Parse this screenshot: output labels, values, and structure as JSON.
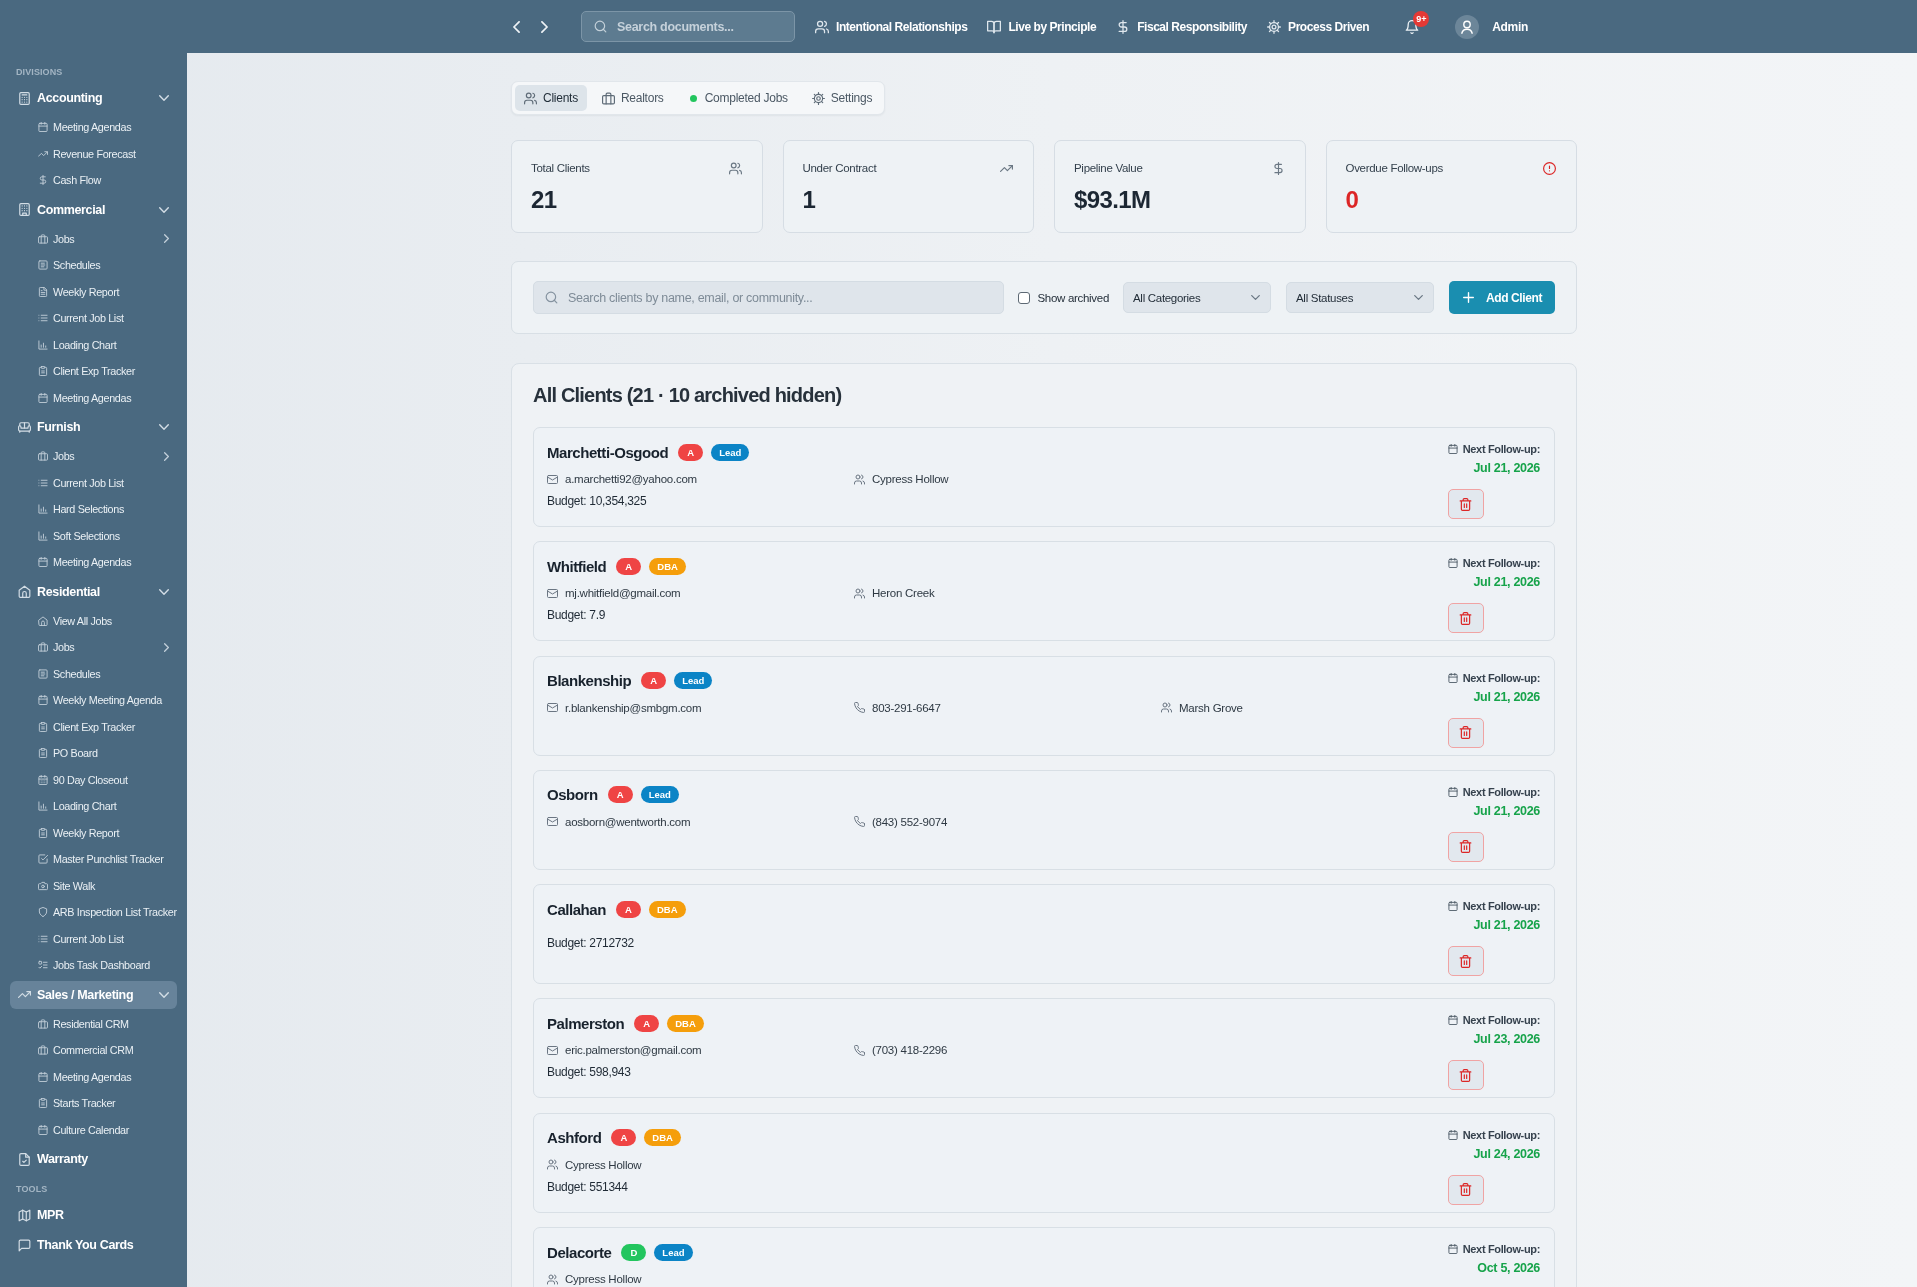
{
  "sidebar": {
    "sections": [
      {
        "label": "DIVISIONS",
        "items": [
          {
            "label": "Accounting",
            "kind": "group",
            "selected": false,
            "expanded": true,
            "children": [
              {
                "label": "Meeting Agendas",
                "kind": "link",
                "selected": false
              },
              {
                "label": "Revenue Forecast",
                "kind": "link",
                "selected": false
              },
              {
                "label": "Cash Flow",
                "kind": "link",
                "selected": false
              }
            ]
          },
          {
            "label": "Commercial",
            "kind": "group",
            "selected": false,
            "expanded": true,
            "children": [
              {
                "label": "Jobs",
                "kind": "submenu",
                "selected": false,
                "expanded": false
              },
              {
                "label": "Schedules",
                "kind": "link",
                "selected": false
              },
              {
                "label": "Weekly Report",
                "kind": "link",
                "selected": false
              },
              {
                "label": "Current Job List",
                "kind": "link",
                "selected": false
              },
              {
                "label": "Loading Chart",
                "kind": "link",
                "selected": false
              },
              {
                "label": "Client Exp Tracker",
                "kind": "link",
                "selected": false
              },
              {
                "label": "Meeting Agendas",
                "kind": "link",
                "selected": false
              }
            ]
          },
          {
            "label": "Furnish",
            "kind": "group",
            "selected": false,
            "expanded": true,
            "children": [
              {
                "label": "Jobs",
                "kind": "submenu",
                "selected": false,
                "expanded": false
              },
              {
                "label": "Current Job List",
                "kind": "link",
                "selected": false
              },
              {
                "label": "Hard Selections",
                "kind": "link",
                "selected": false
              },
              {
                "label": "Soft Selections",
                "kind": "link",
                "selected": false
              },
              {
                "label": "Meeting Agendas",
                "kind": "link",
                "selected": false
              }
            ]
          },
          {
            "label": "Residential",
            "kind": "group",
            "selected": false,
            "expanded": true,
            "children": [
              {
                "label": "View All Jobs",
                "kind": "link",
                "selected": false
              },
              {
                "label": "Jobs",
                "kind": "submenu",
                "selected": false,
                "expanded": false
              },
              {
                "label": "Schedules",
                "kind": "link",
                "selected": false
              },
              {
                "label": "Weekly Meeting Agenda",
                "kind": "link",
                "selected": false
              },
              {
                "label": "Client Exp Tracker",
                "kind": "link",
                "selected": false
              },
              {
                "label": "PO Board",
                "kind": "link",
                "selected": false
              },
              {
                "label": "90 Day Closeout",
                "kind": "link",
                "selected": false
              },
              {
                "label": "Loading Chart",
                "kind": "link",
                "selected": false
              },
              {
                "label": "Weekly Report",
                "kind": "link",
                "selected": false
              },
              {
                "label": "Master Punchlist Tracker",
                "kind": "link",
                "selected": false
              },
              {
                "label": "Site Walk",
                "kind": "link",
                "selected": false
              },
              {
                "label": "ARB Inspection List Tracker",
                "kind": "link",
                "selected": false
              },
              {
                "label": "Current Job List",
                "kind": "link",
                "selected": false
              },
              {
                "label": "Jobs Task Dashboard",
                "kind": "link",
                "selected": false
              }
            ]
          },
          {
            "label": "Sales / Marketing",
            "kind": "group",
            "selected": true,
            "expanded": true,
            "children": [
              {
                "label": "Residential CRM",
                "kind": "link",
                "selected": false
              },
              {
                "label": "Commercial CRM",
                "kind": "link",
                "selected": false
              },
              {
                "label": "Meeting Agendas",
                "kind": "link",
                "selected": false
              },
              {
                "label": "Starts Tracker",
                "kind": "link",
                "selected": false
              },
              {
                "label": "Culture Calendar",
                "kind": "link",
                "selected": false
              }
            ]
          },
          {
            "label": "Warranty",
            "kind": "link",
            "selected": false
          }
        ]
      },
      {
        "label": "TOOLS",
        "items": [
          {
            "label": "MPR",
            "kind": "link",
            "selected": false
          },
          {
            "label": "Thank You Cards",
            "kind": "link",
            "selected": false
          }
        ]
      }
    ]
  },
  "topbar": {
    "search": {
      "placeholder": "Search documents..."
    },
    "links": [
      {
        "label": "Intentional Relationships"
      },
      {
        "label": "Live by Principle"
      },
      {
        "label": "Fiscal Responsibility"
      },
      {
        "label": "Process Driven"
      }
    ],
    "notifications": {
      "badge": "9+"
    },
    "user": {
      "name": "Admin"
    }
  },
  "tabs": [
    {
      "label": "Clients",
      "selected": true
    },
    {
      "label": "Realtors",
      "selected": false
    },
    {
      "label": "Completed Jobs",
      "selected": false
    },
    {
      "label": "Settings",
      "selected": false
    }
  ],
  "stats": [
    {
      "label": "Total Clients",
      "value": "21",
      "alert": false
    },
    {
      "label": "Under Contract",
      "value": "1",
      "alert": false
    },
    {
      "label": "Pipeline Value",
      "value": "$93.1M",
      "alert": false
    },
    {
      "label": "Overdue Follow-ups",
      "value": "0",
      "alert": true
    }
  ],
  "filters": {
    "search": {
      "placeholder": "Search clients by name, email, or community..."
    },
    "show_archived": {
      "label": "Show archived",
      "checked": false
    },
    "category": {
      "value": "All Categories"
    },
    "status": {
      "value": "All Statuses"
    },
    "add_button": {
      "label": "Add Client"
    }
  },
  "client_list": {
    "title": "All Clients (21 · 10 archived hidden)",
    "clients": [
      {
        "name": "Marchetti-Osgood",
        "badges": [
          {
            "label": "A",
            "color": "#ef4444"
          },
          {
            "label": "Lead",
            "color": "#0b84c6"
          }
        ],
        "contacts": [
          {
            "kind": "email",
            "text": "a.marchetti92@yahoo.com"
          },
          {
            "kind": "community",
            "text": "Cypress Hollow"
          }
        ],
        "budget": "Budget: 10,354,325",
        "follow_up": {
          "label": "Next Follow-up:",
          "date": "Jul 21, 2026"
        }
      },
      {
        "name": "Whitfield",
        "badges": [
          {
            "label": "A",
            "color": "#ef4444"
          },
          {
            "label": "DBA",
            "color": "#f59e0b"
          }
        ],
        "contacts": [
          {
            "kind": "email",
            "text": "mj.whitfield@gmail.com"
          },
          {
            "kind": "community",
            "text": "Heron Creek"
          }
        ],
        "budget": "Budget: 7.9",
        "follow_up": {
          "label": "Next Follow-up:",
          "date": "Jul 21, 2026"
        }
      },
      {
        "name": "Blankenship",
        "badges": [
          {
            "label": "A",
            "color": "#ef4444"
          },
          {
            "label": "Lead",
            "color": "#0b84c6"
          }
        ],
        "contacts": [
          {
            "kind": "email",
            "text": "r.blankenship@smbgm.com"
          },
          {
            "kind": "phone",
            "text": "803-291-6647"
          },
          {
            "kind": "community",
            "text": "Marsh Grove"
          }
        ],
        "follow_up": {
          "label": "Next Follow-up:",
          "date": "Jul 21, 2026"
        }
      },
      {
        "name": "Osborn",
        "badges": [
          {
            "label": "A",
            "color": "#ef4444"
          },
          {
            "label": "Lead",
            "color": "#0b84c6"
          }
        ],
        "contacts": [
          {
            "kind": "email",
            "text": "aosborn@wentworth.com"
          },
          {
            "kind": "phone",
            "text": "(843) 552-9074"
          }
        ],
        "follow_up": {
          "label": "Next Follow-up:",
          "date": "Jul 21, 2026"
        }
      },
      {
        "name": "Callahan",
        "badges": [
          {
            "label": "A",
            "color": "#ef4444"
          },
          {
            "label": "DBA",
            "color": "#f59e0b"
          }
        ],
        "budget": "Budget: 2712732",
        "follow_up": {
          "label": "Next Follow-up:",
          "date": "Jul 21, 2026"
        }
      },
      {
        "name": "Palmerston",
        "badges": [
          {
            "label": "A",
            "color": "#ef4444"
          },
          {
            "label": "DBA",
            "color": "#f59e0b"
          }
        ],
        "contacts": [
          {
            "kind": "email",
            "text": "eric.palmerston@gmail.com"
          },
          {
            "kind": "phone",
            "text": "(703) 418-2296"
          }
        ],
        "budget": "Budget: 598,943",
        "follow_up": {
          "label": "Next Follow-up:",
          "date": "Jul 23, 2026"
        }
      },
      {
        "name": "Ashford",
        "badges": [
          {
            "label": "A",
            "color": "#ef4444"
          },
          {
            "label": "DBA",
            "color": "#f59e0b"
          }
        ],
        "contacts": [
          {
            "kind": "community",
            "text": "Cypress Hollow"
          }
        ],
        "budget": "Budget: 551344",
        "follow_up": {
          "label": "Next Follow-up:",
          "date": "Jul 24, 2026"
        }
      },
      {
        "name": "Delacorte",
        "badges": [
          {
            "label": "D",
            "color": "#22c55e"
          },
          {
            "label": "Lead",
            "color": "#0b84c6"
          }
        ],
        "contacts": [
          {
            "kind": "community",
            "text": "Cypress Hollow"
          }
        ],
        "follow_up": {
          "label": "Next Follow-up:",
          "date": "Oct 5, 2026"
        }
      }
    ]
  }
}
